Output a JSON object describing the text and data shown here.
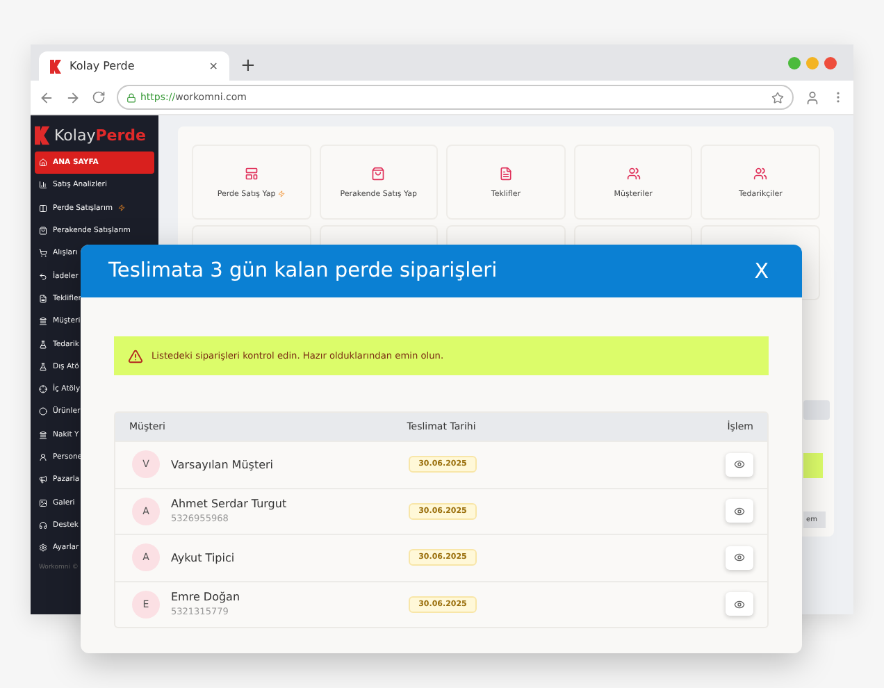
{
  "browser": {
    "tab_title": "Kolay Perde",
    "tab_close": "×",
    "new_tab": "+",
    "url_scheme": "https://",
    "url_host": "workomni.com"
  },
  "sidebar": {
    "logo_first": "Kolay",
    "logo_second": "Perde",
    "items": [
      {
        "label": "ANA SAYFA",
        "selected": true,
        "hot": false
      },
      {
        "label": "Satış Analizleri",
        "selected": false,
        "hot": false
      },
      {
        "label": "Perde Satışlarım",
        "selected": false,
        "hot": true
      },
      {
        "label": "Perakende Satışlarım",
        "selected": false,
        "hot": false
      },
      {
        "label": "Alışları",
        "selected": false,
        "hot": false
      },
      {
        "label": "İadeler",
        "selected": false,
        "hot": false
      },
      {
        "label": "Teklifler",
        "selected": false,
        "hot": false
      },
      {
        "label": "Müşteri",
        "selected": false,
        "hot": false
      },
      {
        "label": "Tedarik",
        "selected": false,
        "hot": false
      },
      {
        "label": "Dış Atö",
        "selected": false,
        "hot": false
      },
      {
        "label": "İç Atöly",
        "selected": false,
        "hot": false
      },
      {
        "label": "Ürünler",
        "selected": false,
        "hot": false
      },
      {
        "label": "Nakit Y",
        "selected": false,
        "hot": false
      },
      {
        "label": "Persone",
        "selected": false,
        "hot": false
      },
      {
        "label": "Pazarla",
        "selected": false,
        "hot": false
      },
      {
        "label": "Galeri",
        "selected": false,
        "hot": false
      },
      {
        "label": "Destek",
        "selected": false,
        "hot": false
      },
      {
        "label": "Ayarlar",
        "selected": false,
        "hot": false
      }
    ],
    "footer": "Workomni ©"
  },
  "cards": [
    {
      "label": "Perde Satış Yap",
      "hot": true
    },
    {
      "label": "Perakende Satış Yap",
      "hot": false
    },
    {
      "label": "Teklifler",
      "hot": false
    },
    {
      "label": "Müşteriler",
      "hot": false
    },
    {
      "label": "Tedarikçiler",
      "hot": false
    }
  ],
  "background_panel": {
    "chip": "em"
  },
  "modal": {
    "title": "Teslimata 3 gün kalan perde siparişleri",
    "close": "X",
    "alert": "Listedeki siparişleri kontrol edin. Hazır olduklarından emin olun.",
    "columns": [
      "Müşteri",
      "Teslimat Tarihi",
      "İşlem"
    ],
    "rows": [
      {
        "initial": "V",
        "name": "Varsayılan Müşteri",
        "date": "30.06.2025"
      },
      {
        "initial": "A",
        "name": "Ahmet Serdar Turgut",
        "phone": "5326955968",
        "date": "30.06.2025"
      },
      {
        "initial": "A",
        "name": "Aykut Tipici",
        "date": "30.06.2025"
      },
      {
        "initial": "E",
        "name": "Emre Doğan",
        "phone": "5321315779",
        "date": "30.06.2025"
      }
    ]
  }
}
